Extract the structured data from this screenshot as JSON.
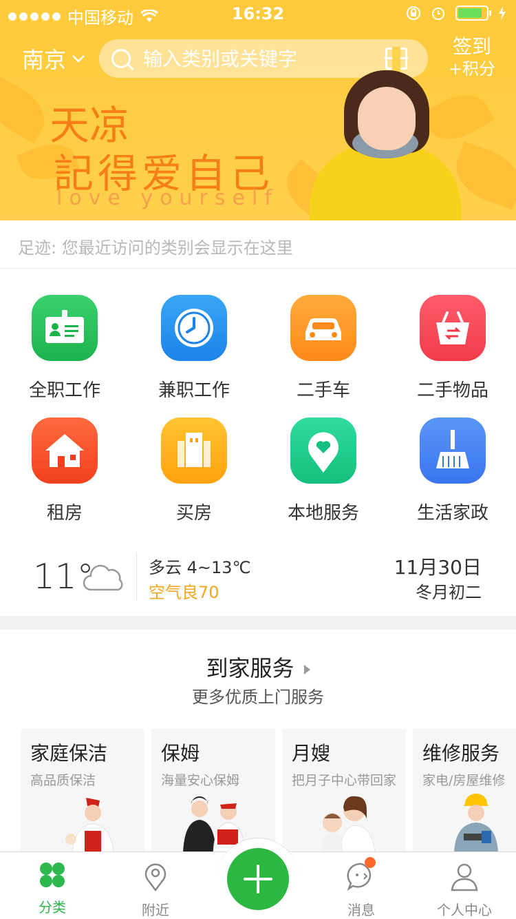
{
  "status_bar": {
    "carrier": "中国移动",
    "time": "16:32",
    "battery_level": 0.85
  },
  "header": {
    "city": "南京",
    "search_placeholder": "输入类别或关键字",
    "checkin_line1": "签到",
    "checkin_line2": "+积分"
  },
  "banner": {
    "line1": "天凉",
    "line2": "記得爱自己",
    "line3": "love yourself"
  },
  "footprint": "足迹: 您最近访问的类别会显示在这里",
  "categories": [
    {
      "label": "全职工作",
      "icon": "id-card-icon"
    },
    {
      "label": "兼职工作",
      "icon": "clock-icon"
    },
    {
      "label": "二手车",
      "icon": "car-icon"
    },
    {
      "label": "二手物品",
      "icon": "basket-icon"
    },
    {
      "label": "租房",
      "icon": "house-icon"
    },
    {
      "label": "买房",
      "icon": "building-icon"
    },
    {
      "label": "本地服务",
      "icon": "map-pin-heart-icon"
    },
    {
      "label": "生活家政",
      "icon": "broom-icon"
    }
  ],
  "weather": {
    "temp": "11°",
    "desc": "多云  4~13℃",
    "aqi": "空气良70",
    "date": "11月30日",
    "lunar": "冬月初二"
  },
  "home_service": {
    "title": "到家服务",
    "subtitle": "更多优质上门服务",
    "cards": [
      {
        "title": "家庭保洁",
        "desc": "高品质保洁"
      },
      {
        "title": "保姆",
        "desc": "海量安心保姆"
      },
      {
        "title": "月嫂",
        "desc": "把月子中心带回家"
      },
      {
        "title": "维修服务",
        "desc": "家电/房屋维修"
      }
    ]
  },
  "tabbar": {
    "tabs": [
      {
        "label": "分类",
        "active": true
      },
      {
        "label": "附近",
        "active": false
      },
      {
        "label": "消息",
        "active": false
      },
      {
        "label": "个人中心",
        "active": false
      }
    ]
  },
  "colors": {
    "brand_green": "#2cb741",
    "header_yellow": "#ffcd42",
    "aqi_orange": "#f5a623",
    "banner_text": "#f57f16"
  }
}
